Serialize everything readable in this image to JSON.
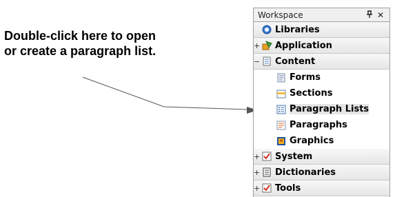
{
  "callout": {
    "line1": "Double-click here to open",
    "line2": "or create a paragraph list."
  },
  "workspace": {
    "title": "Workspace",
    "pin_glyph": "Ȩ",
    "close_glyph": "✕",
    "items": [
      {
        "label": "Libraries",
        "toggle": "",
        "icon": "libraries-icon"
      },
      {
        "label": "Application",
        "toggle": "+",
        "icon": "application-icon"
      },
      {
        "label": "Content",
        "toggle": "−",
        "icon": "content-icon"
      },
      {
        "label": "Forms",
        "icon": "forms-icon"
      },
      {
        "label": "Sections",
        "icon": "sections-icon"
      },
      {
        "label": "Paragraph Lists",
        "icon": "paragraph-lists-icon",
        "selected": true
      },
      {
        "label": "Paragraphs",
        "icon": "paragraphs-icon"
      },
      {
        "label": "Graphics",
        "icon": "graphics-icon"
      },
      {
        "label": "System",
        "toggle": "+",
        "icon": "system-icon"
      },
      {
        "label": "Dictionaries",
        "toggle": "+",
        "icon": "dictionaries-icon"
      },
      {
        "label": "Tools",
        "toggle": "+",
        "icon": "tools-icon"
      }
    ]
  }
}
